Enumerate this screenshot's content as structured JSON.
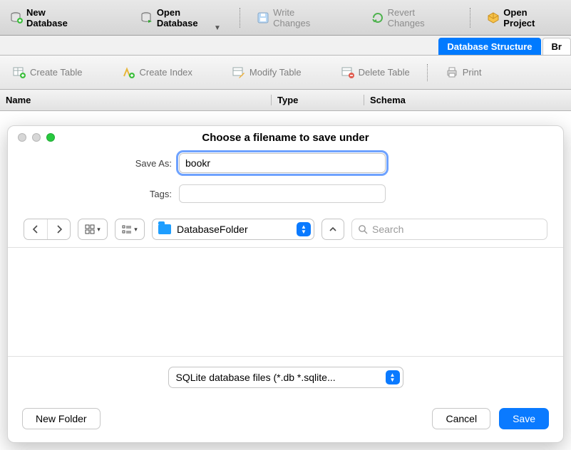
{
  "toolbar": {
    "new_database": "New Database",
    "open_database": "Open Database",
    "write_changes": "Write Changes",
    "revert_changes": "Revert Changes",
    "open_project": "Open Project"
  },
  "tabs": {
    "database_structure": "Database Structure",
    "browse": "Br"
  },
  "actionbar": {
    "create_table": "Create Table",
    "create_index": "Create Index",
    "modify_table": "Modify Table",
    "delete_table": "Delete Table",
    "print": "Print"
  },
  "table_header": {
    "name": "Name",
    "type": "Type",
    "schema": "Schema"
  },
  "dialog": {
    "title": "Choose a filename to save under",
    "save_as_label": "Save As:",
    "save_as_value": "bookr",
    "tags_label": "Tags:",
    "tags_value": "",
    "folder_name": "DatabaseFolder",
    "search_placeholder": "Search",
    "file_type": "SQLite database files (*.db *.sqlite...",
    "new_folder": "New Folder",
    "cancel": "Cancel",
    "save": "Save"
  }
}
